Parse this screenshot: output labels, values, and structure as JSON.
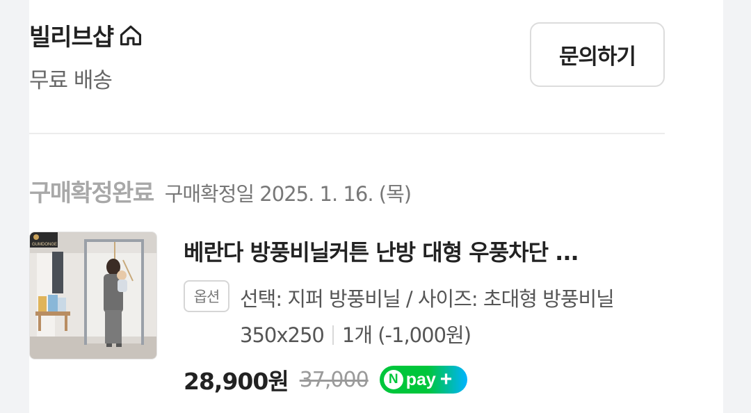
{
  "store": {
    "name": "빌리브샵",
    "home_icon": "home-icon",
    "shipping": "무료 배송",
    "inquiry_label": "문의하기"
  },
  "order": {
    "status": "구매확정완료",
    "confirm_date": "구매확정일 2025. 1. 16. (목)"
  },
  "product": {
    "brand_logo": "GUMDONGE",
    "title": "베란다 방풍비닐커튼 난방 대형 우풍차단 ...",
    "option_badge": "옵션",
    "option_text": "선택: 지퍼 방풍비닐 / 사이즈: 초대형 방풍비닐 350x250",
    "quantity": "1개 (-1,000원)",
    "price": "28,900원",
    "original_price": "37,000",
    "pay_badge": {
      "letter": "N",
      "label": "pay",
      "plus": "+"
    }
  },
  "colors": {
    "npay_green": "#00c63b",
    "npay_blue": "#00b3ff",
    "status_gray": "#a8a8a8"
  }
}
